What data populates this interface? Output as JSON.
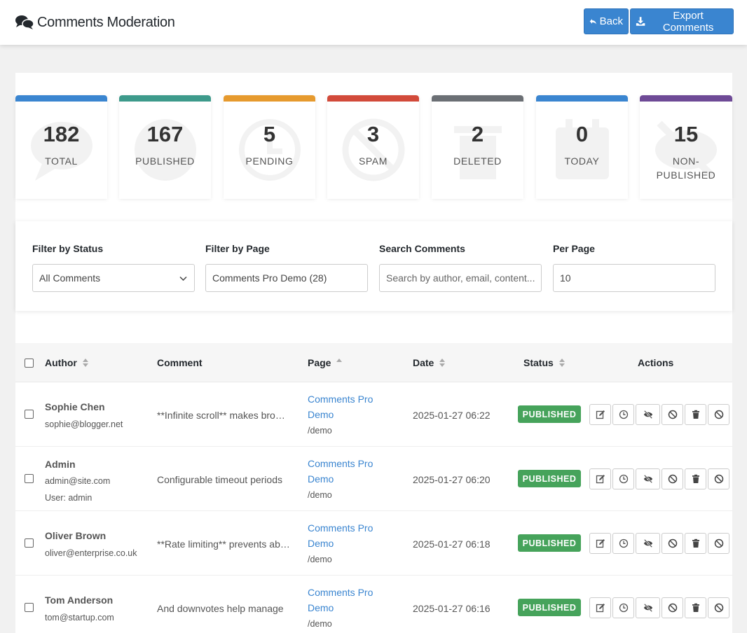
{
  "header": {
    "title": "Comments Moderation",
    "back_label": "Back",
    "export_label": "Export Comments",
    "accent": "#3a85d0"
  },
  "stats": [
    {
      "value": "182",
      "label": "TOTAL",
      "color": "#3a85d0",
      "icon": "comment-icon"
    },
    {
      "value": "167",
      "label": "PUBLISHED",
      "color": "#3d9a8b",
      "icon": "check-circle-icon"
    },
    {
      "value": "5",
      "label": "PENDING",
      "color": "#e69a2e",
      "icon": "clock-icon"
    },
    {
      "value": "3",
      "label": "SPAM",
      "color": "#d24a3a",
      "icon": "ban-icon"
    },
    {
      "value": "2",
      "label": "DELETED",
      "color": "#6b6f74",
      "icon": "trash-icon"
    },
    {
      "value": "0",
      "label": "TODAY",
      "color": "#3a85d0",
      "icon": "calendar-icon"
    },
    {
      "value": "15",
      "label": "NON-PUBLISHED",
      "color": "#6e4a96",
      "icon": "eye-slash-icon"
    }
  ],
  "filters": {
    "status_label": "Filter by Status",
    "status_value": "All Comments",
    "page_label": "Filter by Page",
    "page_value": "Comments Pro Demo (28)",
    "search_label": "Search Comments",
    "search_placeholder": "Search by author, email, content...",
    "perpage_label": "Per Page",
    "perpage_value": "10"
  },
  "table": {
    "columns": {
      "author": "Author",
      "comment": "Comment",
      "page": "Page",
      "date": "Date",
      "status": "Status",
      "actions": "Actions"
    },
    "rows": [
      {
        "author": "Sophie Chen",
        "email": "sophie@blogger.net",
        "user": "",
        "comment": "**Infinite scroll** makes browsing",
        "page_title": "Comments Pro Demo",
        "page_path": "/demo",
        "date": "2025-01-27 06:22",
        "status": "PUBLISHED"
      },
      {
        "author": "Admin",
        "email": "admin@site.com",
        "user": "User: admin",
        "comment": "Configurable timeout periods",
        "page_title": "Comments Pro Demo",
        "page_path": "/demo",
        "date": "2025-01-27 06:20",
        "status": "PUBLISHED"
      },
      {
        "author": "Oliver Brown",
        "email": "oliver@enterprise.co.uk",
        "user": "",
        "comment": "**Rate limiting** prevents abuse",
        "page_title": "Comments Pro Demo",
        "page_path": "/demo",
        "date": "2025-01-27 06:18",
        "status": "PUBLISHED"
      },
      {
        "author": "Tom Anderson",
        "email": "tom@startup.com",
        "user": "",
        "comment": "And downvotes help manage",
        "page_title": "Comments Pro Demo",
        "page_path": "/demo",
        "date": "2025-01-27 06:16",
        "status": "PUBLISHED"
      }
    ],
    "status_color": "#46a35b",
    "action_icons": [
      "edit-icon",
      "clock-icon",
      "eye-slash-icon",
      "ban-icon",
      "trash-icon",
      "block-icon"
    ]
  }
}
